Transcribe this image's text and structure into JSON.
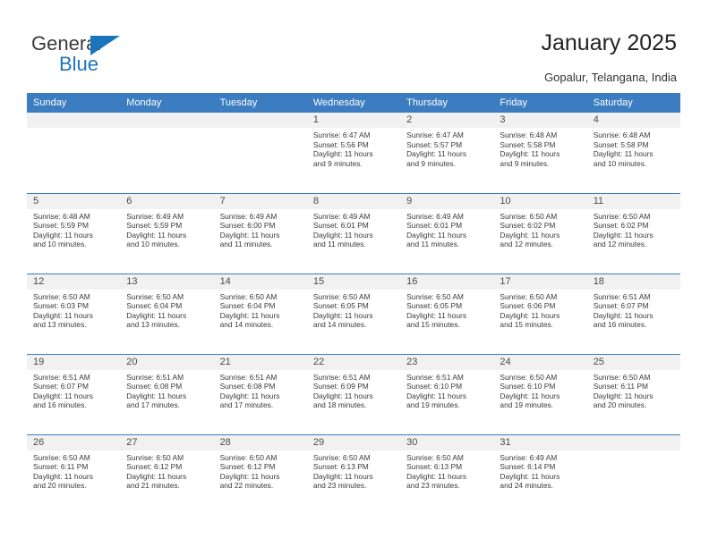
{
  "brand": {
    "name_top": "General",
    "name_bottom": "Blue",
    "triangle_color": "#1b75bb",
    "text_color": "#3c3c3c"
  },
  "header": {
    "title": "January 2025",
    "subtitle": "Gopalur, Telangana, India",
    "accent_color": "#3b7dc0",
    "band_color": "#f1f1f1"
  },
  "weekday_headers": [
    "Sunday",
    "Monday",
    "Tuesday",
    "Wednesday",
    "Thursday",
    "Friday",
    "Saturday"
  ],
  "labels": {
    "sunrise": "Sunrise:",
    "sunset": "Sunset:",
    "daylight": "Daylight:"
  },
  "weeks": [
    [
      {
        "day": "",
        "lines": []
      },
      {
        "day": "",
        "lines": []
      },
      {
        "day": "",
        "lines": []
      },
      {
        "day": "1",
        "lines": [
          "Sunrise: 6:47 AM",
          "Sunset: 5:56 PM",
          "Daylight: 11 hours",
          "and 9 minutes."
        ]
      },
      {
        "day": "2",
        "lines": [
          "Sunrise: 6:47 AM",
          "Sunset: 5:57 PM",
          "Daylight: 11 hours",
          "and 9 minutes."
        ]
      },
      {
        "day": "3",
        "lines": [
          "Sunrise: 6:48 AM",
          "Sunset: 5:58 PM",
          "Daylight: 11 hours",
          "and 9 minutes."
        ]
      },
      {
        "day": "4",
        "lines": [
          "Sunrise: 6:48 AM",
          "Sunset: 5:58 PM",
          "Daylight: 11 hours",
          "and 10 minutes."
        ]
      }
    ],
    [
      {
        "day": "5",
        "lines": [
          "Sunrise: 6:48 AM",
          "Sunset: 5:59 PM",
          "Daylight: 11 hours",
          "and 10 minutes."
        ]
      },
      {
        "day": "6",
        "lines": [
          "Sunrise: 6:49 AM",
          "Sunset: 5:59 PM",
          "Daylight: 11 hours",
          "and 10 minutes."
        ]
      },
      {
        "day": "7",
        "lines": [
          "Sunrise: 6:49 AM",
          "Sunset: 6:00 PM",
          "Daylight: 11 hours",
          "and 11 minutes."
        ]
      },
      {
        "day": "8",
        "lines": [
          "Sunrise: 6:49 AM",
          "Sunset: 6:01 PM",
          "Daylight: 11 hours",
          "and 11 minutes."
        ]
      },
      {
        "day": "9",
        "lines": [
          "Sunrise: 6:49 AM",
          "Sunset: 6:01 PM",
          "Daylight: 11 hours",
          "and 11 minutes."
        ]
      },
      {
        "day": "10",
        "lines": [
          "Sunrise: 6:50 AM",
          "Sunset: 6:02 PM",
          "Daylight: 11 hours",
          "and 12 minutes."
        ]
      },
      {
        "day": "11",
        "lines": [
          "Sunrise: 6:50 AM",
          "Sunset: 6:02 PM",
          "Daylight: 11 hours",
          "and 12 minutes."
        ]
      }
    ],
    [
      {
        "day": "12",
        "lines": [
          "Sunrise: 6:50 AM",
          "Sunset: 6:03 PM",
          "Daylight: 11 hours",
          "and 13 minutes."
        ]
      },
      {
        "day": "13",
        "lines": [
          "Sunrise: 6:50 AM",
          "Sunset: 6:04 PM",
          "Daylight: 11 hours",
          "and 13 minutes."
        ]
      },
      {
        "day": "14",
        "lines": [
          "Sunrise: 6:50 AM",
          "Sunset: 6:04 PM",
          "Daylight: 11 hours",
          "and 14 minutes."
        ]
      },
      {
        "day": "15",
        "lines": [
          "Sunrise: 6:50 AM",
          "Sunset: 6:05 PM",
          "Daylight: 11 hours",
          "and 14 minutes."
        ]
      },
      {
        "day": "16",
        "lines": [
          "Sunrise: 6:50 AM",
          "Sunset: 6:05 PM",
          "Daylight: 11 hours",
          "and 15 minutes."
        ]
      },
      {
        "day": "17",
        "lines": [
          "Sunrise: 6:50 AM",
          "Sunset: 6:06 PM",
          "Daylight: 11 hours",
          "and 15 minutes."
        ]
      },
      {
        "day": "18",
        "lines": [
          "Sunrise: 6:51 AM",
          "Sunset: 6:07 PM",
          "Daylight: 11 hours",
          "and 16 minutes."
        ]
      }
    ],
    [
      {
        "day": "19",
        "lines": [
          "Sunrise: 6:51 AM",
          "Sunset: 6:07 PM",
          "Daylight: 11 hours",
          "and 16 minutes."
        ]
      },
      {
        "day": "20",
        "lines": [
          "Sunrise: 6:51 AM",
          "Sunset: 6:08 PM",
          "Daylight: 11 hours",
          "and 17 minutes."
        ]
      },
      {
        "day": "21",
        "lines": [
          "Sunrise: 6:51 AM",
          "Sunset: 6:08 PM",
          "Daylight: 11 hours",
          "and 17 minutes."
        ]
      },
      {
        "day": "22",
        "lines": [
          "Sunrise: 6:51 AM",
          "Sunset: 6:09 PM",
          "Daylight: 11 hours",
          "and 18 minutes."
        ]
      },
      {
        "day": "23",
        "lines": [
          "Sunrise: 6:51 AM",
          "Sunset: 6:10 PM",
          "Daylight: 11 hours",
          "and 19 minutes."
        ]
      },
      {
        "day": "24",
        "lines": [
          "Sunrise: 6:50 AM",
          "Sunset: 6:10 PM",
          "Daylight: 11 hours",
          "and 19 minutes."
        ]
      },
      {
        "day": "25",
        "lines": [
          "Sunrise: 6:50 AM",
          "Sunset: 6:11 PM",
          "Daylight: 11 hours",
          "and 20 minutes."
        ]
      }
    ],
    [
      {
        "day": "26",
        "lines": [
          "Sunrise: 6:50 AM",
          "Sunset: 6:11 PM",
          "Daylight: 11 hours",
          "and 20 minutes."
        ]
      },
      {
        "day": "27",
        "lines": [
          "Sunrise: 6:50 AM",
          "Sunset: 6:12 PM",
          "Daylight: 11 hours",
          "and 21 minutes."
        ]
      },
      {
        "day": "28",
        "lines": [
          "Sunrise: 6:50 AM",
          "Sunset: 6:12 PM",
          "Daylight: 11 hours",
          "and 22 minutes."
        ]
      },
      {
        "day": "29",
        "lines": [
          "Sunrise: 6:50 AM",
          "Sunset: 6:13 PM",
          "Daylight: 11 hours",
          "and 23 minutes."
        ]
      },
      {
        "day": "30",
        "lines": [
          "Sunrise: 6:50 AM",
          "Sunset: 6:13 PM",
          "Daylight: 11 hours",
          "and 23 minutes."
        ]
      },
      {
        "day": "31",
        "lines": [
          "Sunrise: 6:49 AM",
          "Sunset: 6:14 PM",
          "Daylight: 11 hours",
          "and 24 minutes."
        ]
      },
      {
        "day": "",
        "lines": []
      }
    ]
  ]
}
